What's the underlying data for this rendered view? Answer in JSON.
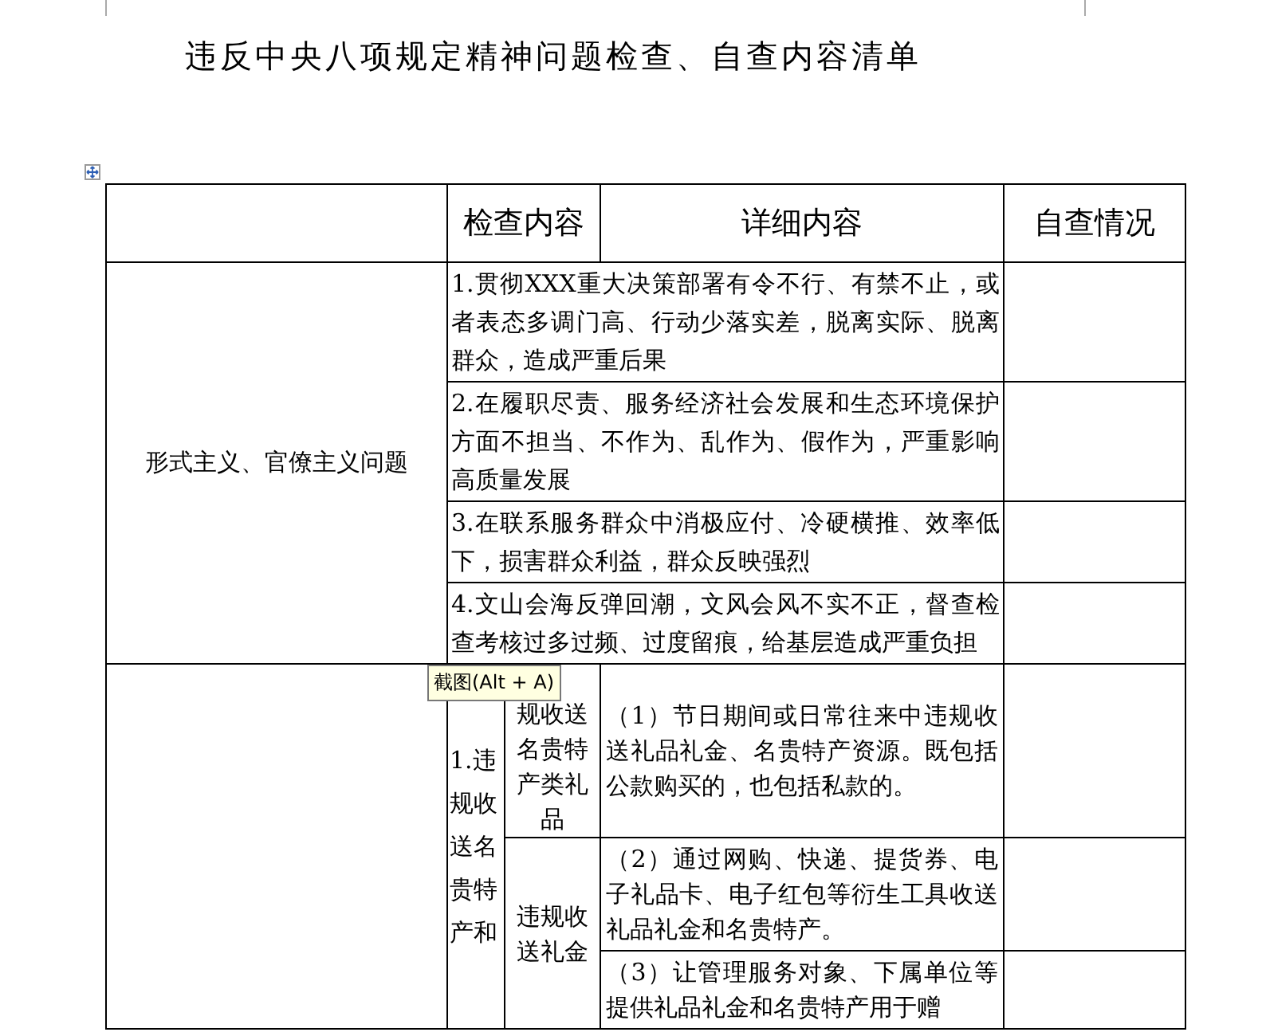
{
  "title": "违反中央八项规定精神问题检查、自查内容清单",
  "table": {
    "columns": [
      {
        "label": "检查内容"
      },
      {
        "label": "详细内容"
      },
      {
        "label": "自查情况"
      }
    ],
    "sections": [
      {
        "kind": "category",
        "category": "形式主义、官僚主义问题",
        "items": [
          {
            "text": "1.贯彻XXX重大决策部署有令不行、有禁不止，或者表态多调门高、行动少落实差，脱离实际、脱离群众，造成严重后果"
          },
          {
            "text": "2.在履职尽责、服务经济社会发展和生态环境保护方面不担当、不作为、乱作为、假作为，严重影响高质量发展"
          },
          {
            "text": "3.在联系服务群众中消极应付、冷硬横推、效率低下，损害群众利益，群众反映强烈"
          },
          {
            "text": "4.文山会海反弹回潮，文风会风不实不正，督查检查考核过多过频、过度留痕，给基层造成严重负担"
          }
        ]
      },
      {
        "kind": "subcategory",
        "item": "1.违规收送名贵特产和",
        "groups": [
          {
            "label": "规收送名贵特产类礼品",
            "items": [
              {
                "text": "（1）节日期间或日常往来中违规收送礼品礼金、名贵特产资源。既包括公款购买的，也包括私款的。"
              }
            ]
          },
          {
            "label": "违规收送礼金",
            "items": [
              {
                "text": "（2）通过网购、快递、提货券、电子礼品卡、电子红包等衍生工具收送礼品礼金和名贵特产。"
              },
              {
                "text": "（3）让管理服务对象、下属单位等提供礼品礼金和名贵特产用于赠"
              }
            ]
          }
        ]
      }
    ]
  },
  "tooltip": {
    "text": "截图(Alt + A)"
  }
}
